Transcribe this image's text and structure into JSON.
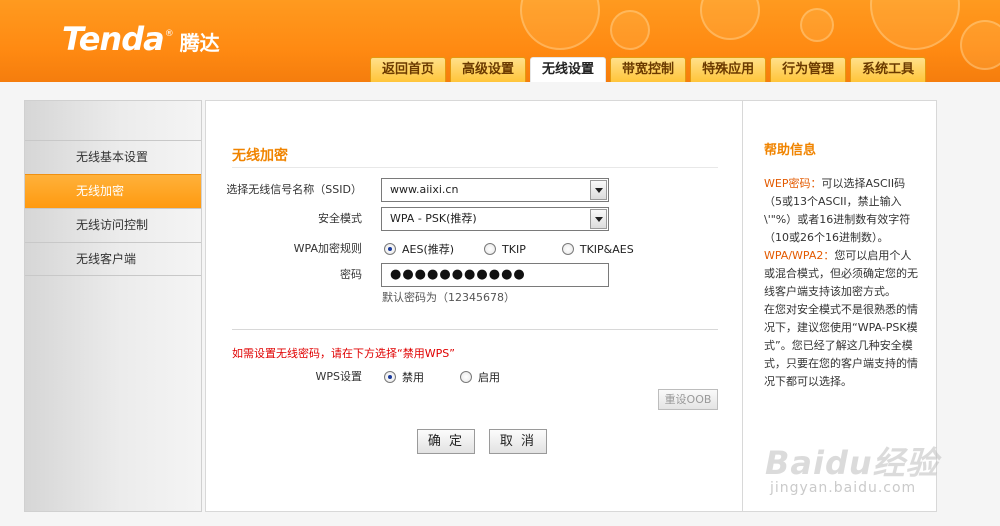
{
  "brand": {
    "name_en": "Tenda",
    "reg": "®",
    "name_cn": "腾达"
  },
  "tabs": [
    {
      "label": "返回首页",
      "active": false
    },
    {
      "label": "高级设置",
      "active": false
    },
    {
      "label": "无线设置",
      "active": true
    },
    {
      "label": "带宽控制",
      "active": false
    },
    {
      "label": "特殊应用",
      "active": false
    },
    {
      "label": "行为管理",
      "active": false
    },
    {
      "label": "系统工具",
      "active": false
    }
  ],
  "sidebar": {
    "items": [
      {
        "label": "无线基本设置",
        "active": false
      },
      {
        "label": "无线加密",
        "active": true
      },
      {
        "label": "无线访问控制",
        "active": false
      },
      {
        "label": "无线客户端",
        "active": false
      }
    ]
  },
  "main": {
    "title": "无线加密",
    "ssid": {
      "label": "选择无线信号名称（SSID）",
      "value": "www.aiixi.cn"
    },
    "security_mode": {
      "label": "安全模式",
      "value": "WPA - PSK(推荐)"
    },
    "wpa_rule": {
      "label": "WPA加密规则",
      "options": [
        "AES(推荐)",
        "TKIP",
        "TKIP&AES"
      ],
      "selected": 0
    },
    "password": {
      "label": "密码",
      "value": "●●●●●●●●●●●",
      "hint": "默认密码为（12345678）"
    },
    "wps_warning": "如需设置无线密码，请在下方选择“禁用WPS”",
    "wps": {
      "label": "WPS设置",
      "options": [
        "禁用",
        "启用"
      ],
      "selected": 0
    },
    "reset_oob": "重设OOB",
    "confirm": "确 定",
    "cancel": "取 消"
  },
  "help": {
    "title": "帮助信息",
    "wep_key": "WEP密码：",
    "wep_text": "可以选择ASCII码（5或13个ASCII，禁止输入\\'\"%）或者16进制数有效字符（10或26个16进制数）。",
    "wpa_key": "WPA/WPA2：",
    "wpa_text": "您可以启用个人或混合模式，但必须确定您的无线客户端支持该加密方式。",
    "tip_text": "在您对安全模式不是很熟悉的情况下，建议您使用“WPA-PSK模式”。您已经了解这几种安全模式，只要在您的客户端支持的情况下都可以选择。"
  },
  "watermark": {
    "main": "Baidu经验",
    "sub": "jingyan.baidu.com"
  }
}
